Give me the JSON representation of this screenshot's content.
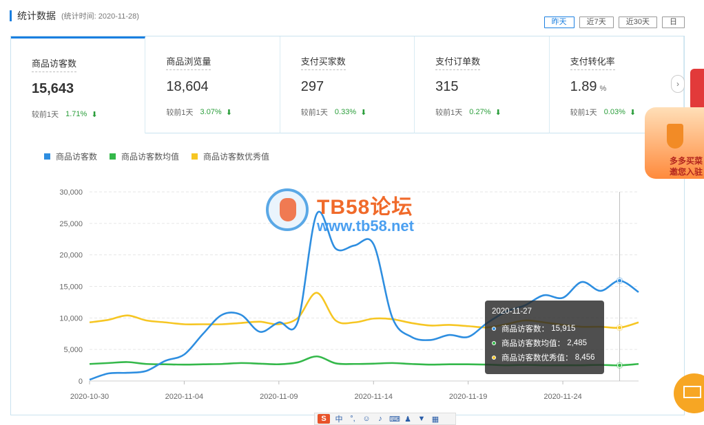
{
  "header": {
    "title": "统计数据",
    "stat_time": "(统计时间: 2020-11-28)"
  },
  "range_tabs": [
    {
      "label": "昨天",
      "active": true
    },
    {
      "label": "近7天",
      "active": false
    },
    {
      "label": "近30天",
      "active": false
    },
    {
      "label": "日",
      "active": false
    }
  ],
  "cards": [
    {
      "name": "商品访客数",
      "value": "15,643",
      "unit": "",
      "compare_label": "较前1天",
      "pct": "1.71%",
      "active": true
    },
    {
      "name": "商品浏览量",
      "value": "18,604",
      "unit": "",
      "compare_label": "较前1天",
      "pct": "3.07%",
      "active": false
    },
    {
      "name": "支付买家数",
      "value": "297",
      "unit": "",
      "compare_label": "较前1天",
      "pct": "0.33%",
      "active": false
    },
    {
      "name": "支付订单数",
      "value": "315",
      "unit": "",
      "compare_label": "较前1天",
      "pct": "0.27%",
      "active": false
    },
    {
      "name": "支付转化率",
      "value": "1.89",
      "unit": "%",
      "compare_label": "较前1天",
      "pct": "0.03%",
      "active": false
    }
  ],
  "next_icon": "chevron-right-icon",
  "chart_data": {
    "type": "line",
    "x": [
      "2020-10-30",
      "2020-10-31",
      "2020-11-01",
      "2020-11-02",
      "2020-11-03",
      "2020-11-04",
      "2020-11-05",
      "2020-11-06",
      "2020-11-07",
      "2020-11-08",
      "2020-11-09",
      "2020-11-10",
      "2020-11-11",
      "2020-11-12",
      "2020-11-13",
      "2020-11-14",
      "2020-11-15",
      "2020-11-16",
      "2020-11-17",
      "2020-11-18",
      "2020-11-19",
      "2020-11-20",
      "2020-11-21",
      "2020-11-22",
      "2020-11-23",
      "2020-11-24",
      "2020-11-25",
      "2020-11-26",
      "2020-11-27",
      "2020-11-28"
    ],
    "x_tick_labels": [
      "2020-10-30",
      "2020-11-04",
      "2020-11-09",
      "2020-11-14",
      "2020-11-19",
      "2020-11-24"
    ],
    "series": [
      {
        "name": "商品访客数",
        "color": "#2e8ee0",
        "values": [
          200,
          1200,
          1300,
          1600,
          3200,
          4200,
          7500,
          10500,
          10500,
          7800,
          9300,
          9400,
          26500,
          21000,
          21500,
          21700,
          10000,
          7000,
          6500,
          7300,
          7000,
          9200,
          11000,
          12000,
          13600,
          13200,
          15700,
          14300,
          15915,
          14100
        ]
      },
      {
        "name": "商品访客数均值",
        "color": "#34b84a",
        "values": [
          2700,
          2850,
          3000,
          2700,
          2650,
          2600,
          2650,
          2700,
          2850,
          2750,
          2650,
          2950,
          3900,
          2800,
          2700,
          2750,
          2850,
          2700,
          2600,
          2650,
          2650,
          2600,
          2500,
          2550,
          2500,
          2500,
          2500,
          2550,
          2485,
          2700
        ]
      },
      {
        "name": "商品访客数优秀值",
        "color": "#f6c623",
        "values": [
          9300,
          9700,
          10400,
          9600,
          9300,
          9000,
          9000,
          9000,
          9200,
          9400,
          9000,
          10000,
          14000,
          9600,
          9300,
          9900,
          9800,
          9200,
          8800,
          8900,
          8700,
          8500,
          9000,
          9600,
          9300,
          8900,
          8600,
          8600,
          8456,
          9300
        ]
      }
    ],
    "ylim": [
      0,
      30000
    ],
    "y_ticks": [
      0,
      5000,
      10000,
      15000,
      20000,
      25000,
      30000
    ],
    "y_tick_labels": [
      "0",
      "5,000",
      "10,000",
      "15,000",
      "20,000",
      "25,000",
      "30,000"
    ],
    "grid": true,
    "legend": "top-left",
    "highlight_index": 28
  },
  "tooltip": {
    "date": "2020-11-27",
    "rows": [
      {
        "label": "商品访客数：",
        "value": "15,915",
        "color": "#2e8ee0"
      },
      {
        "label": "商品访客数均值：",
        "value": "2,485",
        "color": "#34b84a"
      },
      {
        "label": "商品访客数优秀值：",
        "value": "8,456",
        "color": "#f6c623"
      }
    ]
  },
  "watermark": {
    "line1": "TB58论坛",
    "line2": "www.tb58.net"
  },
  "promo": {
    "text_line1": "多多买菜",
    "text_line2": "邀您入驻"
  },
  "ime_bar": {
    "logo": "S",
    "lang": "中",
    "punct": "°,"
  }
}
